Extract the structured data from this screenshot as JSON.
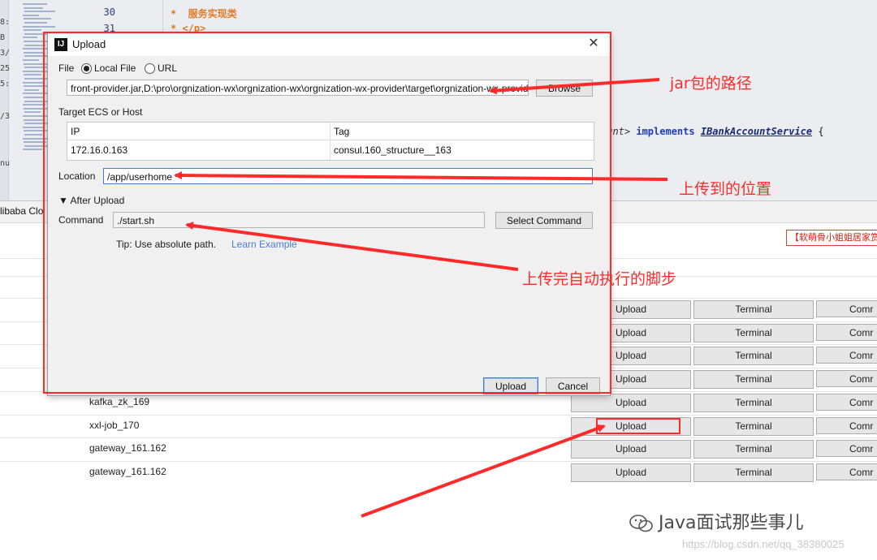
{
  "ide": {
    "gutter_marks": [
      "8:",
      "B",
      "3/",
      "25",
      "5:",
      "/3",
      "nu"
    ],
    "line_numbers": [
      "30",
      "31"
    ],
    "code": {
      "line30": "*  服务实现类",
      "line31": "* </p>",
      "class_frag_1": "ount> ",
      "class_kw": "implements",
      "class_name": "IBankAccountService",
      "brace": " {"
    },
    "tool_tab_label": "libaba Clo",
    "notice_badge": "【软萌骨小姐姐居家赏"
  },
  "hosts": {
    "rows": [
      {
        "name": ""
      },
      {
        "name": ""
      },
      {
        "name": ""
      },
      {
        "name": ""
      },
      {
        "name": "kafka_zk_169"
      },
      {
        "name": "xxl-job_170"
      },
      {
        "name": "gateway_161.162"
      },
      {
        "name": "gateway_161.162"
      }
    ],
    "upload_label": "Upload",
    "terminal_label": "Terminal",
    "comm_label": "Comr"
  },
  "dialog": {
    "title": "Upload",
    "app_icon": "IJ",
    "close": "✕",
    "file_label": "File",
    "local_file_label": "Local File",
    "url_label": "URL",
    "file_path": "front-provider.jar,D:\\pro\\orgnization-wx\\orgnization-wx\\orgnization-wx-provider\\target\\orgnization-wx-provider.jar",
    "browse_label": "Browse",
    "target_label": "Target ECS or Host",
    "col_ip": "IP",
    "col_tag": "Tag",
    "ip_value": "172.16.0.163",
    "tag_value": "consul.160_structure__163",
    "location_label": "Location",
    "location_value": "/app/userhome",
    "after_upload_label": "▼ After Upload",
    "command_label": "Command",
    "command_value": "./start.sh",
    "select_command_label": "Select Command",
    "tip_text": "Tip: Use absolute path.",
    "learn_example": "Learn Example",
    "upload_btn": "Upload",
    "cancel_btn": "Cancel"
  },
  "annotations": {
    "jar_path_note": "jar包的路径",
    "location_note": "上传到的位置",
    "command_note": "上传完自动执行的脚步",
    "color": "#ff2a2a"
  },
  "watermark": {
    "brand": "Java面试那些事儿",
    "url": "https://blog.csdn.net/qq_38380025"
  }
}
